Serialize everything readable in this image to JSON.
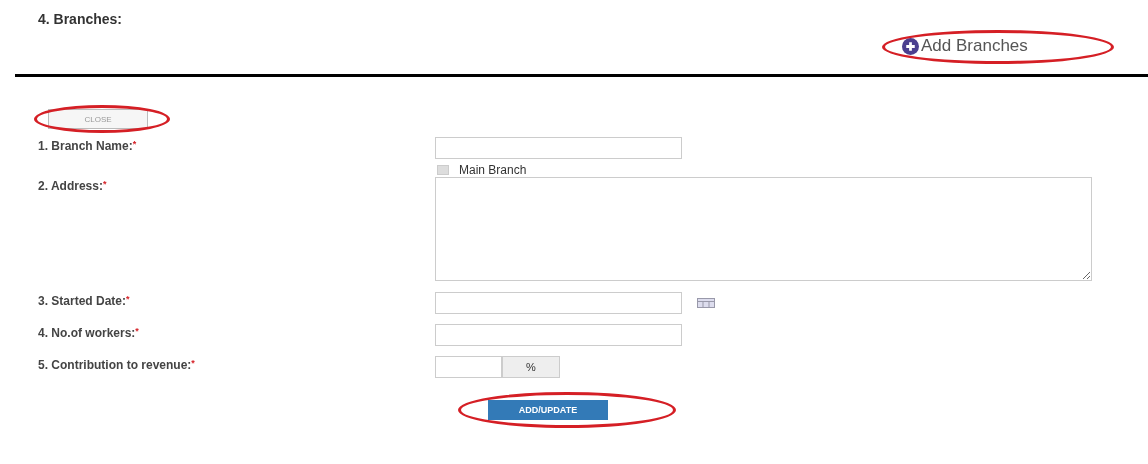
{
  "section_title": "4. Branches:",
  "add_button": {
    "label": "Add Branches"
  },
  "close_button": {
    "label": "CLOSE"
  },
  "fields": [
    {
      "kind": "text",
      "label": "1. Branch Name:",
      "required_mark": "*",
      "checkbox": {
        "label": "Main Branch",
        "checked": false
      }
    },
    {
      "kind": "textarea",
      "label": "2. Address:",
      "required_mark": "*"
    },
    {
      "kind": "date",
      "label": "3. Started Date:",
      "required_mark": "*"
    },
    {
      "kind": "text",
      "label": "4. No.of workers:",
      "required_mark": "*"
    },
    {
      "kind": "percent",
      "label": "5. Contribution to revenue:",
      "required_mark": "*",
      "addon": "%"
    }
  ],
  "submit_button": {
    "label": "ADD/UPDATE"
  }
}
